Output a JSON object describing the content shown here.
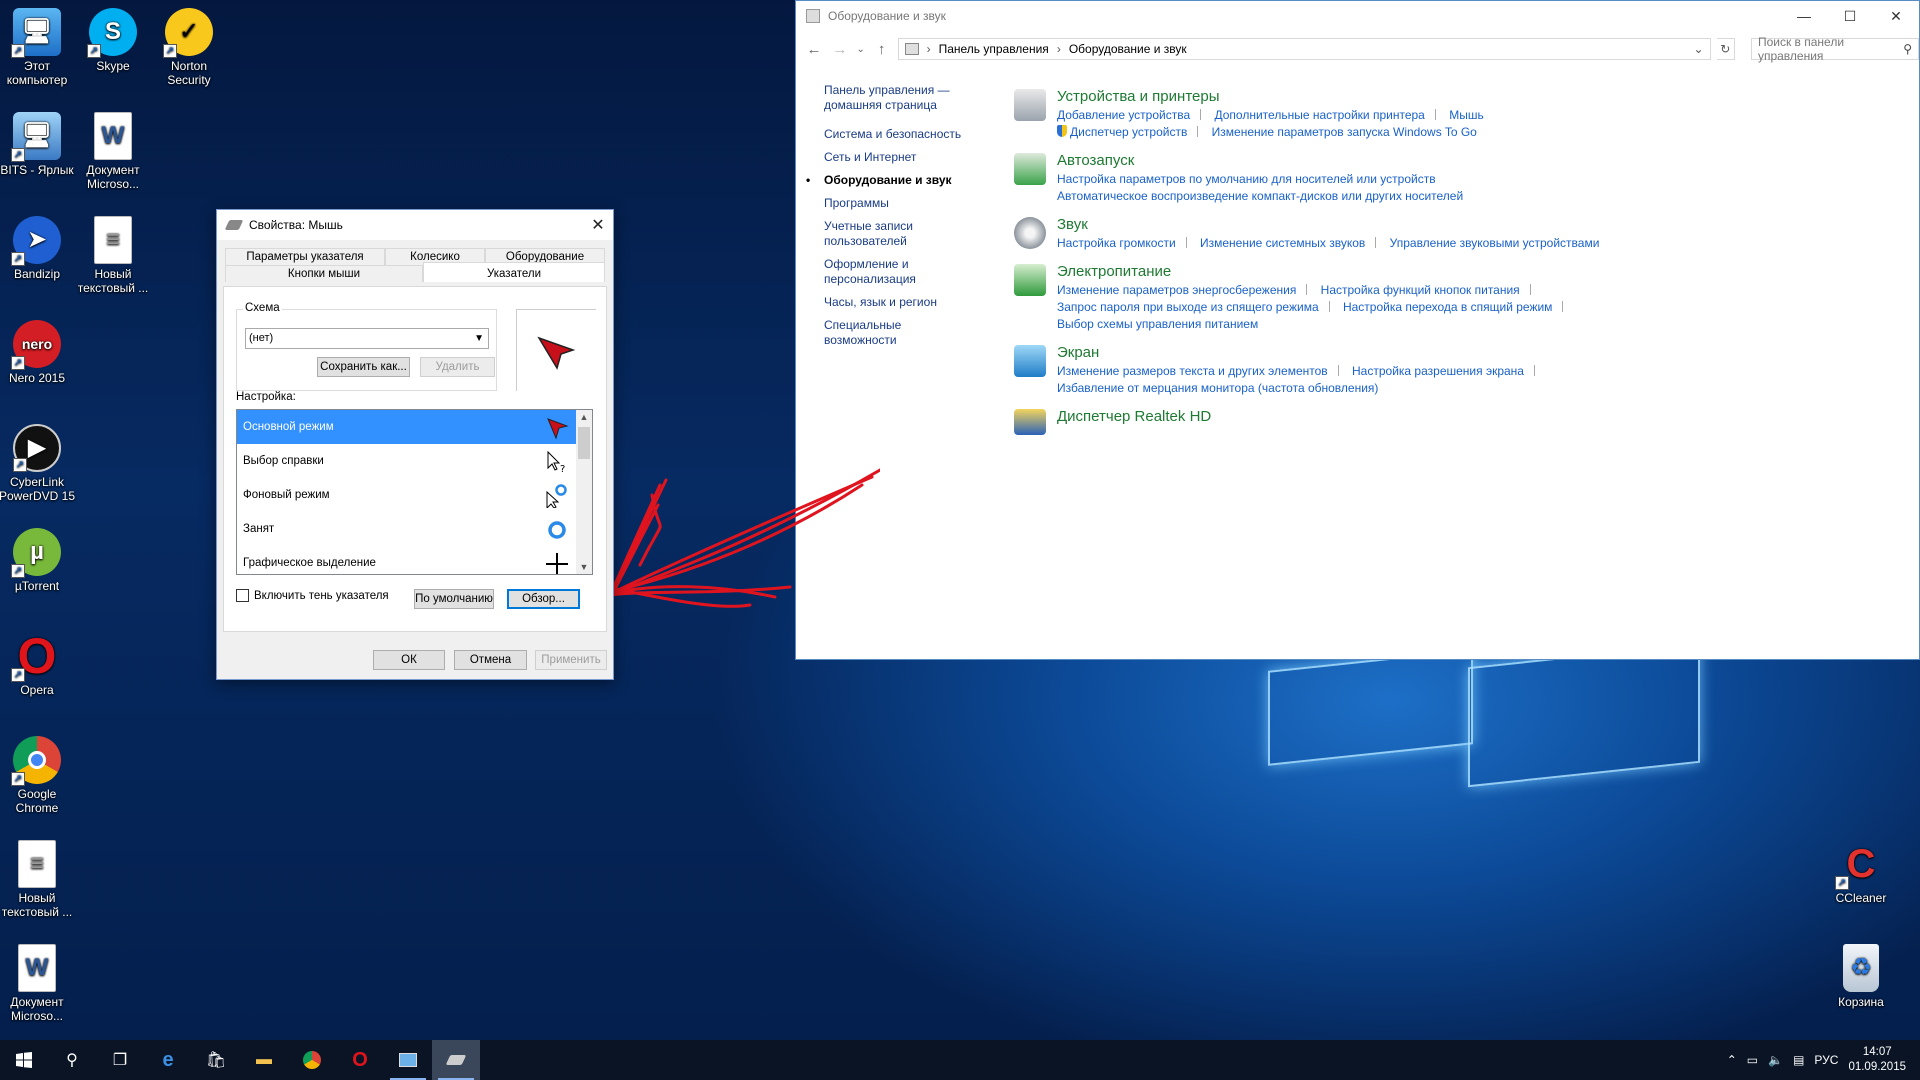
{
  "desktop_icons": [
    {
      "label": "Этот компьютер",
      "icon": "computer-icon"
    },
    {
      "label": "Skype",
      "icon": "skype-icon"
    },
    {
      "label": "Norton Security",
      "icon": "norton-icon"
    },
    {
      "label": "BITS - Ярлык",
      "icon": "computer-shortcut-icon"
    },
    {
      "label": "Документ Microso...",
      "icon": "word-document-icon"
    },
    {
      "label": "Bandizip",
      "icon": "bandizip-icon"
    },
    {
      "label": "Новый текстовый ...",
      "icon": "text-file-icon"
    },
    {
      "label": "Nero 2015",
      "icon": "nero-icon"
    },
    {
      "label": "CyberLink PowerDVD 15",
      "icon": "powerdvd-icon"
    },
    {
      "label": "µTorrent",
      "icon": "utorrent-icon"
    },
    {
      "label": "Opera",
      "icon": "opera-icon"
    },
    {
      "label": "Google Chrome",
      "icon": "chrome-icon"
    },
    {
      "label": "Новый текстовый ...",
      "icon": "text-file-icon"
    },
    {
      "label": "Документ Microso...",
      "icon": "word-document-icon"
    },
    {
      "label": "CCleaner",
      "icon": "ccleaner-icon"
    },
    {
      "label": "Корзина",
      "icon": "recycle-bin-icon"
    }
  ],
  "control_panel": {
    "title": "Оборудование и звук",
    "address": {
      "crumb1": "Панель управления",
      "crumb2": "Оборудование и звук"
    },
    "search_placeholder": "Поиск в панели управления",
    "sidebar": [
      "Панель управления — домашняя страница",
      "Система и безопасность",
      "Сеть и Интернет",
      "Оборудование и звук",
      "Программы",
      "Учетные записи пользователей",
      "Оформление и персонализация",
      "Часы, язык и регион",
      "Специальные возможности"
    ],
    "categories": [
      {
        "title": "Устройства и принтеры",
        "lines": [
          [
            "Добавление устройства",
            "Дополнительные настройки принтера",
            "Мышь"
          ],
          [
            "Диспетчер устройств",
            "Изменение параметров запуска Windows To Go"
          ]
        ]
      },
      {
        "title": "Автозапуск",
        "lines": [
          [
            "Настройка параметров по умолчанию для носителей или устройств"
          ],
          [
            "Автоматическое воспроизведение компакт-дисков или других носителей"
          ]
        ]
      },
      {
        "title": "Звук",
        "lines": [
          [
            "Настройка громкости",
            "Изменение системных звуков",
            "Управление звуковыми устройствами"
          ]
        ]
      },
      {
        "title": "Электропитание",
        "lines": [
          [
            "Изменение параметров энергосбережения",
            "Настройка функций кнопок питания"
          ],
          [
            "Запрос пароля при выходе из спящего режима",
            "Настройка перехода в спящий режим"
          ],
          [
            "Выбор схемы управления питанием"
          ]
        ]
      },
      {
        "title": "Экран",
        "lines": [
          [
            "Изменение размеров текста и других элементов",
            "Настройка разрешения экрана"
          ],
          [
            "Избавление от мерцания монитора (частота обновления)"
          ]
        ]
      },
      {
        "title": "Диспетчер Realtek HD",
        "lines": []
      }
    ]
  },
  "dialog": {
    "title": "Свойства: Мышь",
    "tabs_row1": [
      "Параметры указателя",
      "Колесико",
      "Оборудование"
    ],
    "tabs_row2": [
      "Кнопки мыши",
      "Указатели"
    ],
    "scheme_label": "Схема",
    "scheme_value": "(нет)",
    "save_as": "Сохранить как...",
    "delete": "Удалить",
    "customize_label": "Настройка:",
    "pointers": [
      "Основной режим",
      "Выбор справки",
      "Фоновый режим",
      "Занят",
      "Графическое выделение"
    ],
    "shadow_label": "Включить тень указателя",
    "default_btn": "По умолчанию",
    "browse_btn": "Обзор...",
    "ok": "ОК",
    "cancel": "Отмена",
    "apply": "Применить"
  },
  "tray": {
    "lang": "РУС",
    "time": "14:07",
    "date": "01.09.2015"
  }
}
